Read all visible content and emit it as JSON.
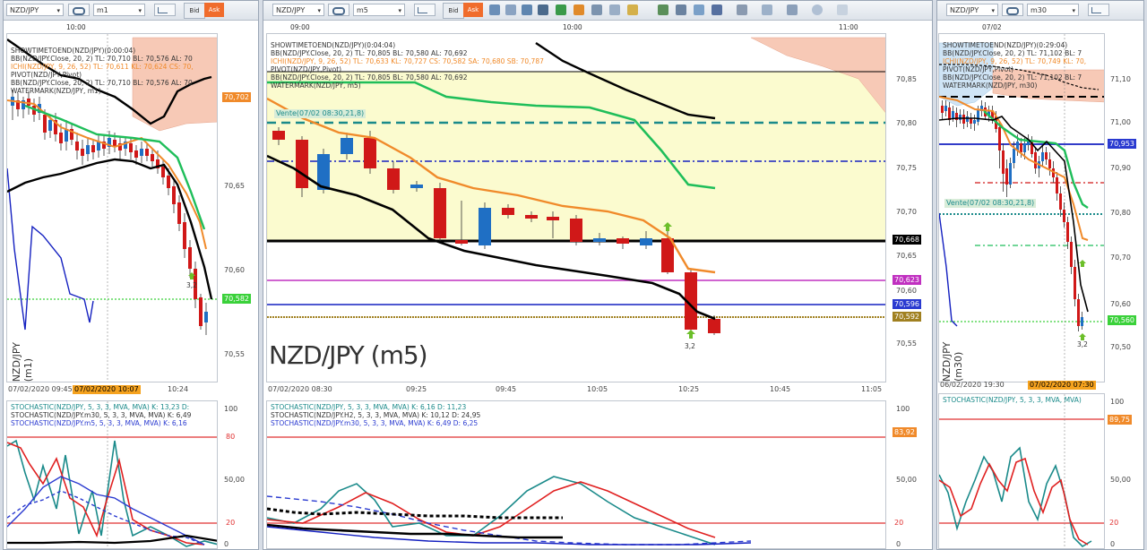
{
  "panes": [
    {
      "symbol": "NZD/JPY",
      "timeframe": "m1",
      "bid_label": "Bid",
      "ask_label": "Ask",
      "top_time": "10:00",
      "price_ticks": [
        "70,65",
        "70,60",
        "70,55"
      ],
      "price_boxes": [
        {
          "value": "70,702",
          "color": "#f08a2a"
        },
        {
          "value": "70,582",
          "color": "#3ad13a"
        }
      ],
      "indicators": [
        {
          "text": "SHOWTIMETOEND(NZD/JPY)(0:00:04)",
          "color": "#000000"
        },
        {
          "text": "BB(NZD/JPY.Close, 20, 2)  TL: 70,710  BL: 70,576  AL: 70",
          "color": "#222222"
        },
        {
          "text": "ICHI(NZD/JPY, 9, 26, 52)  TL: 70,611  KL: 70,624  CS: 70,",
          "color": "#f08a2a"
        },
        {
          "text": "PIVOT(NZD/JPY,Pivot)",
          "color": "#222222"
        },
        {
          "text": "BB(NZD/JPY.Close, 20, 2)  TL: 70,710  BL: 70,576  AL: 70",
          "color": "#222222"
        },
        {
          "text": "WATERMARK(NZD/JPY, m1)",
          "color": "#222222"
        }
      ],
      "marker_label": "3,2",
      "watermark": "NZD/JPY (m1)",
      "date_axis": {
        "left": "07/02/2020 09:45",
        "highlight": "07/02/2020 10:07",
        "right": "10:24"
      },
      "osc_indicators": [
        {
          "text": "STOCHASTIC(NZD/JPY, 5, 3, 3, MVA, MVA)  K: 13,23  D:",
          "color": "#1a8a8a"
        },
        {
          "text": "STOCHASTIC(NZD/JPY.m30, 5, 3, 3, MVA, MVA)  K: 6,49",
          "color": "#222222"
        },
        {
          "text": "STOCHASTIC(NZD/JPY.m5, 5, 3, 3, MVA, MVA)  K: 6,16",
          "color": "#2a3ad0"
        }
      ],
      "osc_ticks": [
        "100",
        "50,00",
        "0"
      ],
      "osc_boxes": [
        {
          "value": "80",
          "color": "#e03030"
        },
        {
          "value": "20",
          "color": "#e03030"
        }
      ]
    },
    {
      "symbol": "NZD/JPY",
      "timeframe": "m5",
      "bid_label": "Bid",
      "ask_label": "Ask",
      "top_times": [
        "09:00",
        "10:00",
        "11:00"
      ],
      "price_ticks": [
        "70,85",
        "70,80",
        "70,75",
        "70,70",
        "70,65",
        "70,60",
        "70,55"
      ],
      "price_boxes": [
        {
          "value": "70,668",
          "color": "#000000"
        },
        {
          "value": "70,623",
          "color": "#c030c0"
        },
        {
          "value": "70,596",
          "color": "#2a3ad0"
        },
        {
          "value": "70,592",
          "color": "#a08020"
        }
      ],
      "indicators": [
        {
          "text": "SHOWTIMETOEND(NZD/JPY)(0:04:04)",
          "color": "#000000"
        },
        {
          "text": "BB(NZD/JPY.Close, 20, 2)  TL: 70,805  BL: 70,580  AL: 70,692",
          "color": "#222222"
        },
        {
          "text": "ICHI(NZD/JPY, 9, 26, 52)  TL: 70,633  KL: 70,727  CS: 70,582  SA: 70,680  SB: 70,787",
          "color": "#f08a2a"
        },
        {
          "text": "PIVOT(NZD/JPY,Pivot)",
          "color": "#222222"
        },
        {
          "text": "BB(NZD/JPY.Close, 20, 2)  TL: 70,805  BL: 70,580  AL: 70,692",
          "color": "#222222"
        },
        {
          "text": "WATERMARK(NZD/JPY, m5)",
          "color": "#222222"
        }
      ],
      "vente_label": "Vente(07/02 08:30,21,8)",
      "marker_label": "3,2",
      "watermark": "NZD/JPY (m5)",
      "date_axis": {
        "ticks": [
          "07/02/2020 08:30",
          "09:25",
          "09:45",
          "10:05",
          "10:25",
          "10:45",
          "11:05"
        ]
      },
      "osc_indicators": [
        {
          "text": "STOCHASTIC(NZD/JPY, 5, 3, 3, MVA, MVA)  K: 6,16  D: 11,23",
          "color": "#1a8a8a"
        },
        {
          "text": "STOCHASTIC(NZD/JPY.H2, 5, 3, 3, MVA, MVA)  K: 10,12  D: 24,95",
          "color": "#222222"
        },
        {
          "text": "STOCHASTIC(NZD/JPY.m30, 5, 3, 3, MVA, MVA)  K: 6,49  D: 6,25",
          "color": "#2a3ad0"
        }
      ],
      "osc_ticks": [
        "100",
        "50,00",
        "0"
      ],
      "osc_boxes": [
        {
          "value": "83,92",
          "color": "#f08a2a"
        },
        {
          "value": "20",
          "color": "#e03030"
        }
      ]
    },
    {
      "symbol": "NZD/JPY",
      "timeframe": "m30",
      "top_time": "07/02",
      "price_ticks": [
        "71,10",
        "71,00",
        "70,90",
        "70,80",
        "70,70",
        "70,60",
        "70,50"
      ],
      "price_boxes": [
        {
          "value": "70,953",
          "color": "#2a3ad0"
        },
        {
          "value": "70,560",
          "color": "#3ad13a"
        }
      ],
      "indicators": [
        {
          "text": "SHOWTIMETOEND(NZD/JPY)(0:29:04)",
          "color": "#000000"
        },
        {
          "text": "BB(NZD/JPY.Close, 20, 2)  TL: 71,102  BL: 7",
          "color": "#222222"
        },
        {
          "text": "ICHI(NZD/JPY, 9, 26, 52)  TL: 70,749  KL: 70,",
          "color": "#f08a2a"
        },
        {
          "text": "PIVOT(NZD/JPY,Pivot)",
          "color": "#222222"
        },
        {
          "text": "BB(NZD/JPY.Close, 20, 2)  TL: 71,102  BL: 7",
          "color": "#222222"
        },
        {
          "text": "WATERMARK(NZD/JPY, m30)",
          "color": "#222222"
        }
      ],
      "vente_label": "Vente(07/02 08:30,21,8)",
      "marker_label": "3,2",
      "watermark": "NZD/JPY (m30)",
      "date_axis": {
        "left": "06/02/2020 19:30",
        "highlight": "07/02/2020 07:30"
      },
      "osc_indicators": [
        {
          "text": "STOCHASTIC(NZD/JPY, 5, 3, 3, MVA, MVA)",
          "color": "#1a8a8a"
        }
      ],
      "osc_ticks": [
        "100",
        "50,00",
        "0"
      ],
      "osc_boxes": [
        {
          "value": "89,75",
          "color": "#f08a2a"
        },
        {
          "value": "20",
          "color": "#e03030"
        }
      ]
    }
  ],
  "colors": {
    "bull": "#1f6fc4",
    "bear": "#d01818",
    "bb": "#000000",
    "kijun": "#1fbe5a",
    "tenkan": "#f08a2a",
    "stoch_k": "#1a8a8a",
    "stoch_d": "#e02020"
  }
}
